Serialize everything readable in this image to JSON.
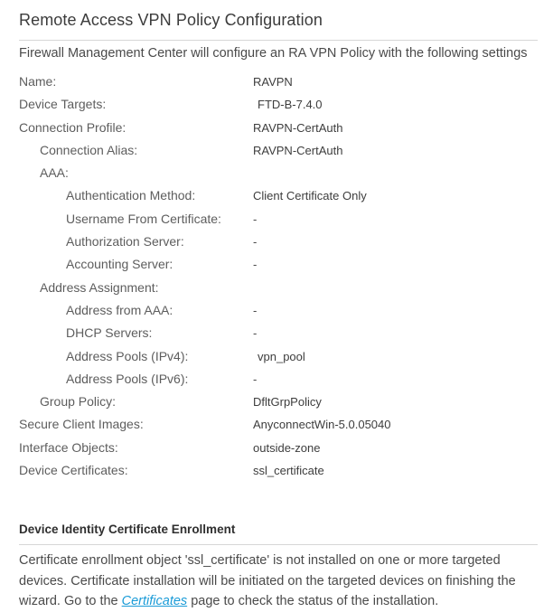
{
  "header": {
    "title": "Remote Access VPN Policy Configuration",
    "intro": "Firewall Management Center will configure an RA VPN Policy with the following settings"
  },
  "settings": [
    {
      "label": "Name:",
      "value": "RAVPN",
      "indent": 0,
      "nudge": false
    },
    {
      "label": "Device Targets:",
      "value": "FTD-B-7.4.0",
      "indent": 0,
      "nudge": true
    },
    {
      "label": "Connection Profile:",
      "value": "RAVPN-CertAuth",
      "indent": 0,
      "nudge": false
    },
    {
      "label": "Connection Alias:",
      "value": "RAVPN-CertAuth",
      "indent": 1,
      "nudge": false
    },
    {
      "label": "AAA:",
      "value": "",
      "indent": 1,
      "nudge": false
    },
    {
      "label": "Authentication Method:",
      "value": "Client Certificate Only",
      "indent": 2,
      "nudge": false
    },
    {
      "label": "Username From Certificate:",
      "value": "-",
      "indent": 2,
      "nudge": false
    },
    {
      "label": "Authorization Server:",
      "value": "-",
      "indent": 2,
      "nudge": false
    },
    {
      "label": "Accounting Server:",
      "value": "-",
      "indent": 2,
      "nudge": false
    },
    {
      "label": "Address Assignment:",
      "value": "",
      "indent": 1,
      "nudge": false
    },
    {
      "label": "Address from AAA:",
      "value": "-",
      "indent": 2,
      "nudge": false
    },
    {
      "label": "DHCP Servers:",
      "value": "-",
      "indent": 2,
      "nudge": false
    },
    {
      "label": "Address Pools (IPv4):",
      "value": "vpn_pool",
      "indent": 2,
      "nudge": true
    },
    {
      "label": "Address Pools (IPv6):",
      "value": "-",
      "indent": 2,
      "nudge": false
    },
    {
      "label": "Group Policy:",
      "value": "DfltGrpPolicy",
      "indent": 1,
      "nudge": false
    },
    {
      "label": "Secure Client Images:",
      "value": "AnyconnectWin-5.0.05040",
      "indent": 0,
      "nudge": false
    },
    {
      "label": "Interface Objects:",
      "value": "outside-zone",
      "indent": 0,
      "nudge": false
    },
    {
      "label": "Device Certificates:",
      "value": "ssl_certificate",
      "indent": 0,
      "nudge": false
    }
  ],
  "enrollment": {
    "subtitle": "Device Identity Certificate Enrollment",
    "note_part1": "Certificate enrollment object 'ssl_certificate' is not installed on one or more targeted devices. Certificate installation will be initiated on the targeted devices on finishing the wizard. Go to the ",
    "note_link": "Certificates",
    "note_part2": " page to check the status of the installation."
  },
  "colors": {
    "link": "#1a9bd7",
    "label_text": "#5d5d5d",
    "value_text": "#3d3d3d",
    "divider": "#d6d6d6"
  }
}
